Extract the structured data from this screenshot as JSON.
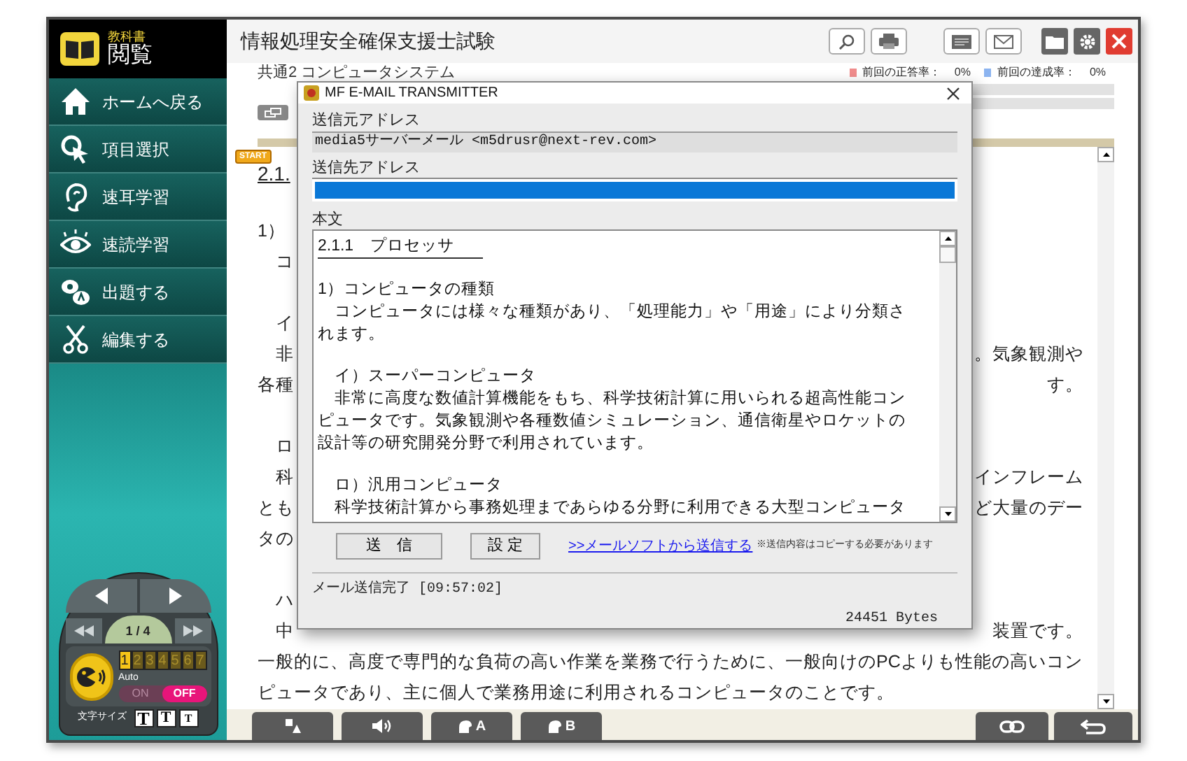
{
  "app": {
    "logo_small": "教科書",
    "logo_large": "閲覧"
  },
  "menu": [
    {
      "label": "ホームへ戻る"
    },
    {
      "label": "項目選択"
    },
    {
      "label": "速耳学習"
    },
    {
      "label": "速読学習"
    },
    {
      "label": "出題する"
    },
    {
      "label": "編集する"
    }
  ],
  "pager": {
    "page": "1 / 4"
  },
  "speed": [
    {
      "label": "1",
      "selected": true
    },
    {
      "label": "2",
      "selected": false
    },
    {
      "label": "3",
      "selected": false
    },
    {
      "label": "4",
      "selected": false
    },
    {
      "label": "5",
      "selected": false
    },
    {
      "label": "6",
      "selected": false
    },
    {
      "label": "7",
      "selected": false
    }
  ],
  "auto": {
    "label": "Auto",
    "options": [
      {
        "label": "ON",
        "selected": false
      },
      {
        "label": "OFF",
        "selected": true
      }
    ]
  },
  "font_size": {
    "label": "文字サイズ",
    "options": [
      "T",
      "T",
      "T"
    ]
  },
  "header": {
    "title": "情報処理安全確保支援士試験"
  },
  "stats": [
    {
      "label": "前回の正答率：",
      "value": "0%",
      "color": "#f08c8c",
      "level": 0
    },
    {
      "label": "前回の達成率：",
      "value": "0%",
      "color": "#8cb4f0",
      "level": 0
    }
  ],
  "document": {
    "section": "共通2 コンピュータシステム",
    "start_badge": "START",
    "heading": "2.1.",
    "paragraphs": [
      {
        "lines": [
          {
            "left": "1）"
          },
          {
            "left": "　コ"
          }
        ]
      },
      {
        "lines": [
          {
            "left": "　イ"
          },
          {
            "left": "　非",
            "right": "。気象観測や"
          },
          {
            "left": "各種",
            "right": "す。"
          }
        ]
      },
      {
        "lines": [
          {
            "left": "　ロ"
          },
          {
            "left": "　科",
            "right": "インフレーム"
          },
          {
            "left": "とも",
            "right": "ど大量のデー"
          },
          {
            "left": "タの"
          }
        ]
      },
      {
        "lines": [
          {
            "left": "　ハ"
          },
          {
            "left": "　中",
            "right": "装置です。"
          },
          {
            "left": "一般的に、高度で専門的な負荷の高い作業を業務で行うために、一般向けのPCよりも性能の高いコン"
          },
          {
            "left": "ピュータであり、主に個人で業務用途に利用されるコンピュータのことです。"
          }
        ]
      }
    ]
  },
  "bottom_toolbar": {
    "a_label": "A",
    "b_label": "B"
  },
  "dialog": {
    "title": "MF E-MAIL TRANSMITTER",
    "from_label": "送信元アドレス",
    "from_value": "media5サーバーメール <m5drusr@next-rev.com>",
    "to_label": "送信先アドレス",
    "body_label": "本文",
    "body": [
      {
        "lines": [
          {
            "text": "2.1.1　プロセッサ",
            "kind": "heading"
          }
        ]
      },
      {
        "lines": [
          {
            "text": "1）コンピュータの種類",
            "kind": "text"
          },
          {
            "text": "　コンピュータには様々な種類があり、「処理能力」や「用途」により分類さ",
            "kind": "text"
          },
          {
            "text": "れます。",
            "kind": "text"
          }
        ]
      },
      {
        "lines": [
          {
            "text": "　イ）スーパーコンピュータ",
            "kind": "text"
          },
          {
            "text": "　非常に高度な数値計算機能をもち、科学技術計算に用いられる超高性能コン",
            "kind": "text"
          },
          {
            "text": "ピュータです。気象観測や各種数値シミュレーション、通信衛星やロケットの",
            "kind": "text"
          },
          {
            "text": "設計等の研究開発分野で利用されています。",
            "kind": "text"
          }
        ]
      },
      {
        "lines": [
          {
            "text": "　ロ）汎用コンピュータ",
            "kind": "text"
          },
          {
            "text": "　科学技術計算から事務処理まであらゆる分野に利用できる大型コンピュータ",
            "kind": "text"
          }
        ]
      }
    ],
    "buttons": [
      "送　信",
      "設 定"
    ],
    "link": ">>メールソフトから送信する",
    "note": "※送信内容はコピーする必要があります",
    "status": "メール送信完了 [09:57:02]",
    "bytes": "24451 Bytes"
  }
}
